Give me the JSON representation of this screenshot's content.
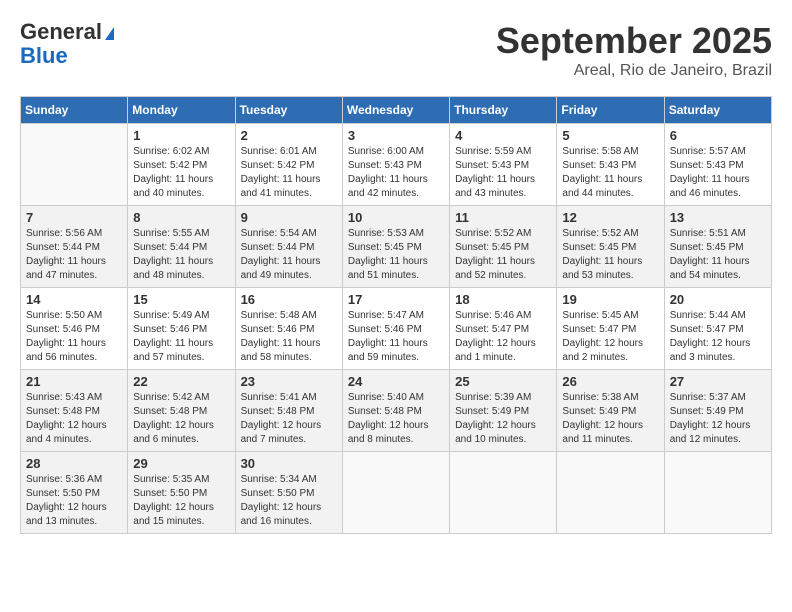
{
  "header": {
    "logo_general": "General",
    "logo_blue": "Blue",
    "month_title": "September 2025",
    "location": "Areal, Rio de Janeiro, Brazil"
  },
  "calendar": {
    "days_of_week": [
      "Sunday",
      "Monday",
      "Tuesday",
      "Wednesday",
      "Thursday",
      "Friday",
      "Saturday"
    ],
    "weeks": [
      [
        {
          "day": "",
          "info": ""
        },
        {
          "day": "1",
          "info": "Sunrise: 6:02 AM\nSunset: 5:42 PM\nDaylight: 11 hours\nand 40 minutes."
        },
        {
          "day": "2",
          "info": "Sunrise: 6:01 AM\nSunset: 5:42 PM\nDaylight: 11 hours\nand 41 minutes."
        },
        {
          "day": "3",
          "info": "Sunrise: 6:00 AM\nSunset: 5:43 PM\nDaylight: 11 hours\nand 42 minutes."
        },
        {
          "day": "4",
          "info": "Sunrise: 5:59 AM\nSunset: 5:43 PM\nDaylight: 11 hours\nand 43 minutes."
        },
        {
          "day": "5",
          "info": "Sunrise: 5:58 AM\nSunset: 5:43 PM\nDaylight: 11 hours\nand 44 minutes."
        },
        {
          "day": "6",
          "info": "Sunrise: 5:57 AM\nSunset: 5:43 PM\nDaylight: 11 hours\nand 46 minutes."
        }
      ],
      [
        {
          "day": "7",
          "info": "Sunrise: 5:56 AM\nSunset: 5:44 PM\nDaylight: 11 hours\nand 47 minutes."
        },
        {
          "day": "8",
          "info": "Sunrise: 5:55 AM\nSunset: 5:44 PM\nDaylight: 11 hours\nand 48 minutes."
        },
        {
          "day": "9",
          "info": "Sunrise: 5:54 AM\nSunset: 5:44 PM\nDaylight: 11 hours\nand 49 minutes."
        },
        {
          "day": "10",
          "info": "Sunrise: 5:53 AM\nSunset: 5:45 PM\nDaylight: 11 hours\nand 51 minutes."
        },
        {
          "day": "11",
          "info": "Sunrise: 5:52 AM\nSunset: 5:45 PM\nDaylight: 11 hours\nand 52 minutes."
        },
        {
          "day": "12",
          "info": "Sunrise: 5:52 AM\nSunset: 5:45 PM\nDaylight: 11 hours\nand 53 minutes."
        },
        {
          "day": "13",
          "info": "Sunrise: 5:51 AM\nSunset: 5:45 PM\nDaylight: 11 hours\nand 54 minutes."
        }
      ],
      [
        {
          "day": "14",
          "info": "Sunrise: 5:50 AM\nSunset: 5:46 PM\nDaylight: 11 hours\nand 56 minutes."
        },
        {
          "day": "15",
          "info": "Sunrise: 5:49 AM\nSunset: 5:46 PM\nDaylight: 11 hours\nand 57 minutes."
        },
        {
          "day": "16",
          "info": "Sunrise: 5:48 AM\nSunset: 5:46 PM\nDaylight: 11 hours\nand 58 minutes."
        },
        {
          "day": "17",
          "info": "Sunrise: 5:47 AM\nSunset: 5:46 PM\nDaylight: 11 hours\nand 59 minutes."
        },
        {
          "day": "18",
          "info": "Sunrise: 5:46 AM\nSunset: 5:47 PM\nDaylight: 12 hours\nand 1 minute."
        },
        {
          "day": "19",
          "info": "Sunrise: 5:45 AM\nSunset: 5:47 PM\nDaylight: 12 hours\nand 2 minutes."
        },
        {
          "day": "20",
          "info": "Sunrise: 5:44 AM\nSunset: 5:47 PM\nDaylight: 12 hours\nand 3 minutes."
        }
      ],
      [
        {
          "day": "21",
          "info": "Sunrise: 5:43 AM\nSunset: 5:48 PM\nDaylight: 12 hours\nand 4 minutes."
        },
        {
          "day": "22",
          "info": "Sunrise: 5:42 AM\nSunset: 5:48 PM\nDaylight: 12 hours\nand 6 minutes."
        },
        {
          "day": "23",
          "info": "Sunrise: 5:41 AM\nSunset: 5:48 PM\nDaylight: 12 hours\nand 7 minutes."
        },
        {
          "day": "24",
          "info": "Sunrise: 5:40 AM\nSunset: 5:48 PM\nDaylight: 12 hours\nand 8 minutes."
        },
        {
          "day": "25",
          "info": "Sunrise: 5:39 AM\nSunset: 5:49 PM\nDaylight: 12 hours\nand 10 minutes."
        },
        {
          "day": "26",
          "info": "Sunrise: 5:38 AM\nSunset: 5:49 PM\nDaylight: 12 hours\nand 11 minutes."
        },
        {
          "day": "27",
          "info": "Sunrise: 5:37 AM\nSunset: 5:49 PM\nDaylight: 12 hours\nand 12 minutes."
        }
      ],
      [
        {
          "day": "28",
          "info": "Sunrise: 5:36 AM\nSunset: 5:50 PM\nDaylight: 12 hours\nand 13 minutes."
        },
        {
          "day": "29",
          "info": "Sunrise: 5:35 AM\nSunset: 5:50 PM\nDaylight: 12 hours\nand 15 minutes."
        },
        {
          "day": "30",
          "info": "Sunrise: 5:34 AM\nSunset: 5:50 PM\nDaylight: 12 hours\nand 16 minutes."
        },
        {
          "day": "",
          "info": ""
        },
        {
          "day": "",
          "info": ""
        },
        {
          "day": "",
          "info": ""
        },
        {
          "day": "",
          "info": ""
        }
      ]
    ]
  }
}
